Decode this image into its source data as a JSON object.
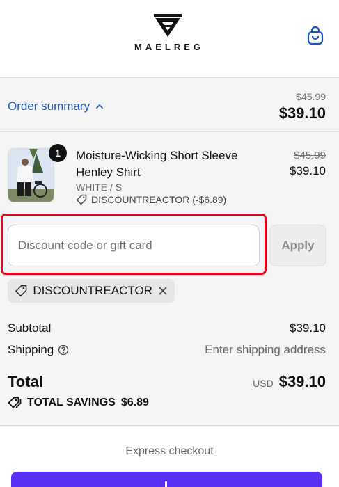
{
  "header": {
    "brand": "MAELREG",
    "cart_icon": "shopping-bag-icon"
  },
  "summary": {
    "toggle_label": "Order summary",
    "toggle_icon": "chevron-up-icon",
    "original_total": "$45.99",
    "total": "$39.10"
  },
  "product": {
    "quantity": "1",
    "name": "Moisture-Wicking Short Sleeve Henley Shirt",
    "variant": "WHITE / S",
    "discount": "DISCOUNTREACTOR (-$6.89)",
    "original_price": "$45.99",
    "price": "$39.10"
  },
  "discount_form": {
    "placeholder": "Discount code or gift card",
    "value": "",
    "apply_label": "Apply",
    "applied_code": "DISCOUNTREACTOR"
  },
  "totals": {
    "subtotal_label": "Subtotal",
    "subtotal_value": "$39.10",
    "shipping_label": "Shipping",
    "shipping_value": "Enter shipping address",
    "total_label": "Total",
    "currency": "USD",
    "total_value": "$39.10",
    "savings_label": "TOTAL SAVINGS",
    "savings_value": "$6.89"
  },
  "express": {
    "label": "Express checkout"
  },
  "colors": {
    "accent_link": "#1a56b6",
    "highlight": "#e3061c",
    "express_button": "#5a31f4",
    "panel_bg": "#f5f5f5"
  }
}
